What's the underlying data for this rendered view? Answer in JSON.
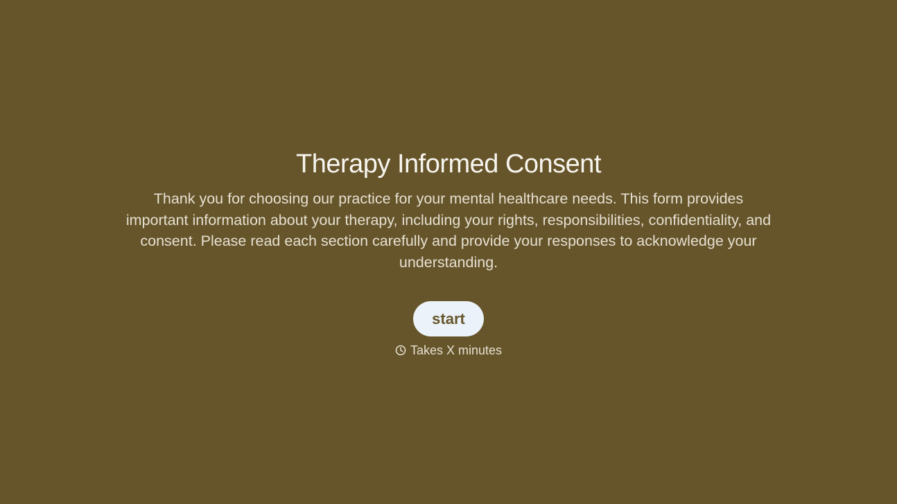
{
  "form": {
    "title": "Therapy Informed Consent",
    "description": "Thank you for choosing our practice for your mental healthcare needs. This form provides important information about your therapy, including your rights, responsibilities, confidentiality, and consent. Please read each section carefully and provide your responses to acknowledge your understanding.",
    "start_label": "start",
    "duration_text": "Takes X minutes",
    "duration_icon": "clock-icon"
  },
  "colors": {
    "background": "#66552A",
    "button_background": "#EBF2FA",
    "button_text": "#66552A",
    "title_text": "#F7F5EF",
    "body_text": "#E6E0D2"
  }
}
